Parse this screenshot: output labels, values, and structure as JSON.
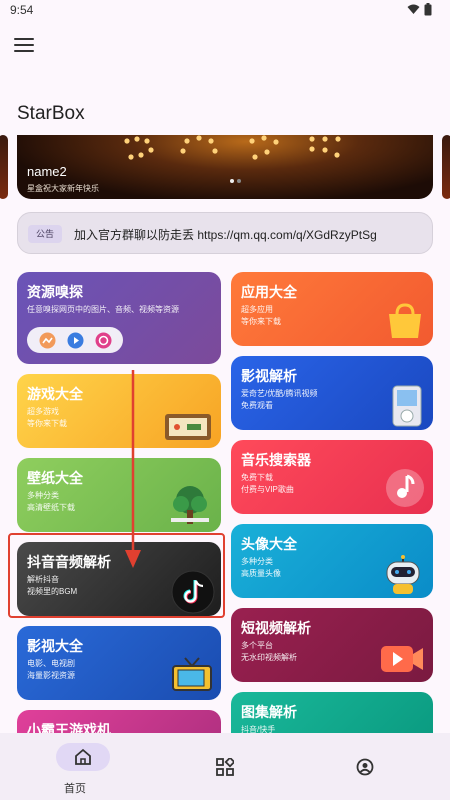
{
  "status": {
    "time": "9:54"
  },
  "app": {
    "title": "StarBox"
  },
  "banner": {
    "name": "name2",
    "subtitle": "星盒祝大家新年快乐"
  },
  "notice": {
    "badge": "公告",
    "text": "加入官方群聊以防走丢 https://qm.qq.com/q/XGdRzyPtSg"
  },
  "cards_left": [
    {
      "title": "资源嗅探",
      "sub1": "任意嗅探网页中的图片、音频、视频等资源",
      "sub2": ""
    },
    {
      "title": "游戏大全",
      "sub1": "超多游戏",
      "sub2": "等你来下载"
    },
    {
      "title": "壁纸大全",
      "sub1": "多种分类",
      "sub2": "高清壁纸下载"
    },
    {
      "title": "抖音音频解析",
      "sub1": "解析抖音",
      "sub2": "视频里的BGM"
    },
    {
      "title": "影视大全",
      "sub1": "电影、电视剧",
      "sub2": "海量影视资源"
    },
    {
      "title": "小霸王游戏机",
      "sub1": "",
      "sub2": ""
    }
  ],
  "cards_right": [
    {
      "title": "应用大全",
      "sub1": "超多应用",
      "sub2": "等你来下载"
    },
    {
      "title": "影视解析",
      "sub1": "爱奇艺/优酷/腾讯视频",
      "sub2": "免费观看"
    },
    {
      "title": "音乐搜索器",
      "sub1": "免费下载",
      "sub2": "付费与VIP歌曲"
    },
    {
      "title": "头像大全",
      "sub1": "多种分类",
      "sub2": "高质量头像"
    },
    {
      "title": "短视频解析",
      "sub1": "多个平台",
      "sub2": "无水印视频解析"
    },
    {
      "title": "图集解析",
      "sub1": "抖音/快手",
      "sub2": ""
    }
  ],
  "nav": {
    "home": "首页",
    "apps": "",
    "profile": ""
  },
  "colors": {
    "accent": "#e1d8f5",
    "highlight": "#e04030"
  }
}
